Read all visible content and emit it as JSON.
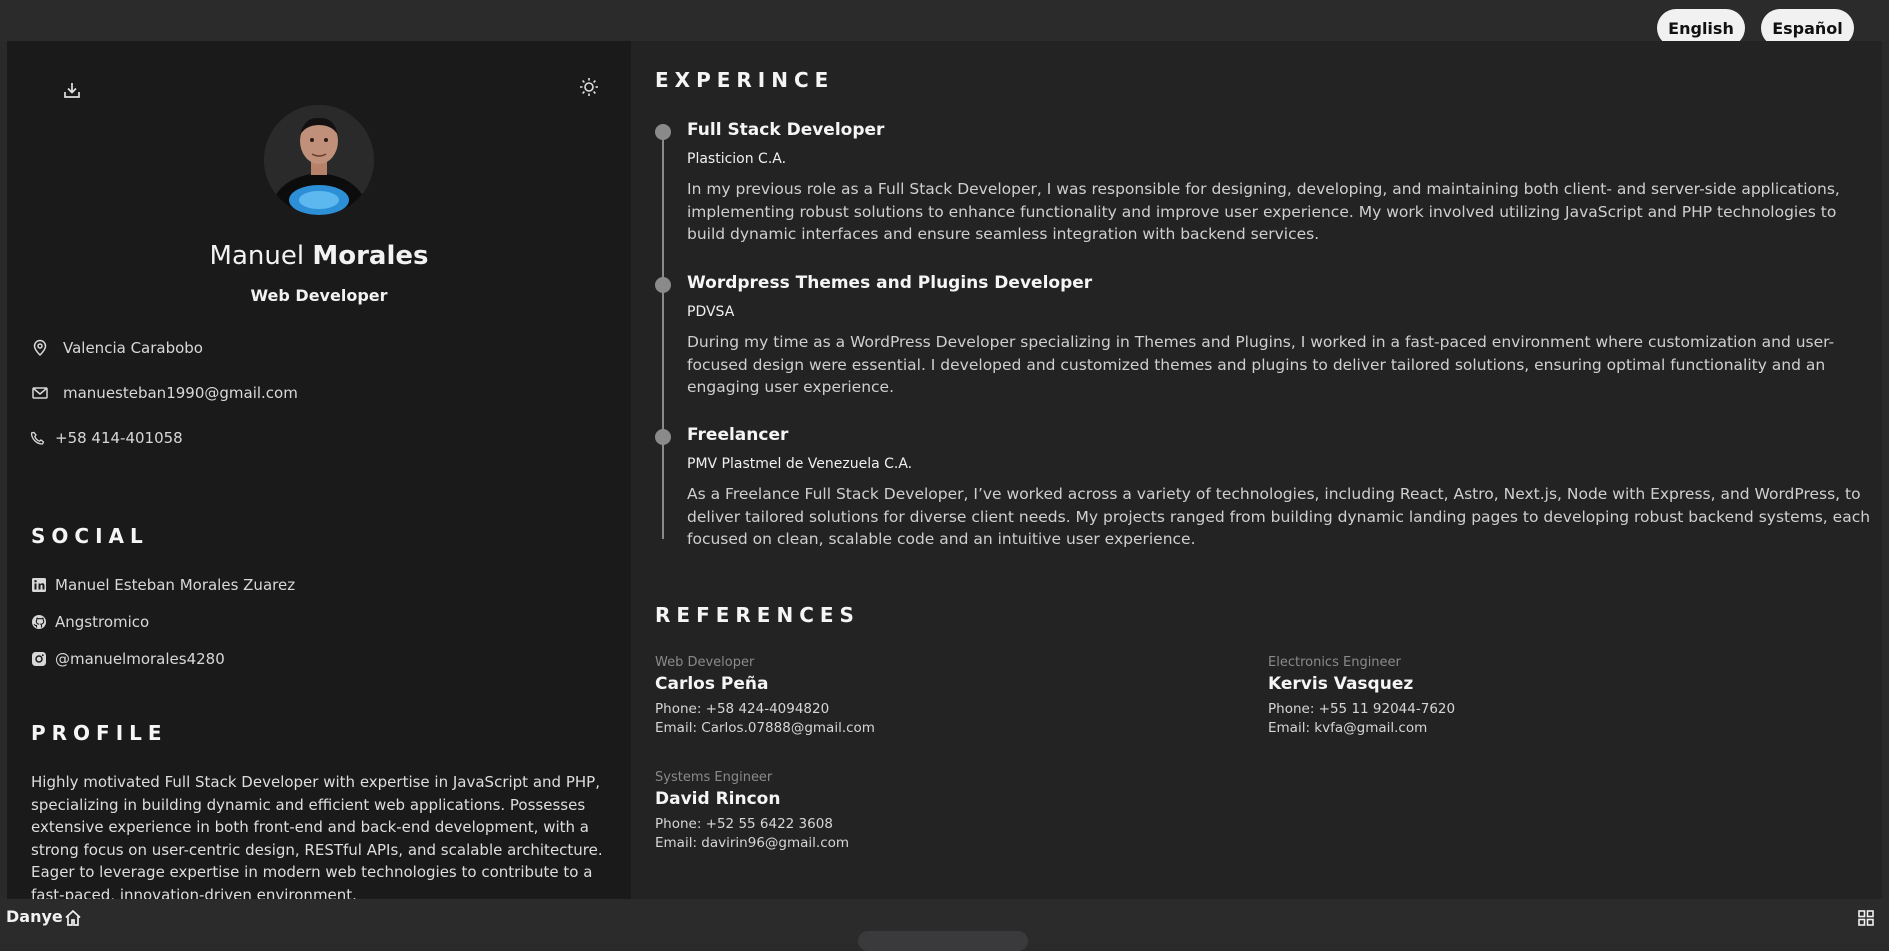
{
  "languages": {
    "english": "English",
    "spanish": "Español"
  },
  "sidebar": {
    "name_first": "Manuel",
    "name_last": "Morales",
    "role": "Web Developer",
    "contacts": {
      "location": "Valencia Carabobo",
      "email": "manuesteban1990@gmail.com",
      "phone": "+58 414-401058"
    },
    "social_title": "SOCIAL",
    "social": {
      "linkedin": "Manuel Esteban Morales Zuarez",
      "github": "Angstromico",
      "instagram": "@manuelmorales4280"
    },
    "profile_title": "PROFILE",
    "profile_text": "Highly motivated Full Stack Developer with expertise in JavaScript and PHP, specializing in building dynamic and efficient web applications. Possesses extensive experience in both front-end and back-end development, with a strong focus on user-centric design, RESTful APIs, and scalable architecture. Eager to leverage expertise in modern web technologies to contribute to a fast-paced, innovation-driven environment."
  },
  "experience": {
    "title": "EXPERINCE",
    "jobs": [
      {
        "title": "Full Stack Developer",
        "company": "Plasticion C.A.",
        "description": "In my previous role as a Full Stack Developer, I was responsible for designing, developing, and maintaining both client- and server-side applications, implementing robust solutions to enhance functionality and improve user experience. My work involved utilizing JavaScript and PHP technologies to build dynamic interfaces and ensure seamless integration with backend services."
      },
      {
        "title": "Wordpress Themes and Plugins Developer",
        "company": "PDVSA",
        "description": "During my time as a WordPress Developer specializing in Themes and Plugins, I worked in a fast-paced environment where customization and user-focused design were essential. I developed and customized themes and plugins to deliver tailored solutions, ensuring optimal functionality and an engaging user experience."
      },
      {
        "title": "Freelancer",
        "company": "PMV Plastmel de Venezuela C.A.",
        "description": "As a Freelance Full Stack Developer, I’ve worked across a variety of technologies, including React, Astro, Next.js, Node with Express, and WordPress, to deliver tailored solutions for diverse client needs. My projects ranged from building dynamic landing pages to developing robust backend systems, each focused on clean, scalable code and an intuitive user experience."
      }
    ]
  },
  "references": {
    "title": "REFERENCES",
    "items": [
      {
        "role": "Web Developer",
        "name": "Carlos Peña",
        "phone": "Phone: +58 424-4094820",
        "email": "Email: Carlos.07888@gmail.com"
      },
      {
        "role": "Electronics Engineer",
        "name": "Kervis Vasquez",
        "phone": "Phone: +55 11 92044-7620",
        "email": "Email: kvfa@gmail.com"
      },
      {
        "role": "Systems Engineer",
        "name": "David Rincon",
        "phone": "Phone: +52 55 6422 3608",
        "email": "Email: davirin96@gmail.com"
      }
    ]
  },
  "taskbar": {
    "label": "Danye"
  },
  "icons": {
    "download": "download-icon",
    "theme": "sun-icon",
    "location": "map-pin-icon",
    "email": "mail-icon",
    "phone": "phone-icon",
    "linkedin": "linkedin-icon",
    "github": "github-icon",
    "instagram": "instagram-icon",
    "home": "home-icon",
    "grid": "grid-icon"
  },
  "colors": {
    "background": "#232323",
    "sidebar": "#1b1a1b",
    "timeline": "#8a8a8a",
    "button": "#f1f1f1"
  }
}
